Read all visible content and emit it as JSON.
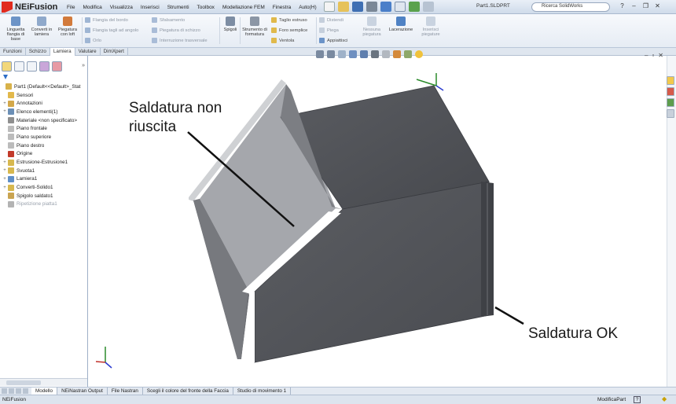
{
  "app": {
    "logo_text": "NEiFusion",
    "document_title": "Part1.SLDPRT",
    "search_placeholder": "Ricerca SolidWorks",
    "menus": [
      "File",
      "Modifica",
      "Visualizza",
      "Inserisci",
      "Strumenti",
      "Toolbox",
      "Modellazione FEM",
      "Finestra",
      "Auto(H)"
    ]
  },
  "ribbon": {
    "linguetta": "Linguetta flangia di base",
    "converti": "Converti in lamiera",
    "piegatura_loft": "Piegatura con loft",
    "flangia_bordo": "Flangia del bordo",
    "flangia_tagli": "Flangia tagli ad angolo",
    "orlo": "Orlo",
    "sfalsamento": "Sfalsamento",
    "piegatura_schizzo": "Piegatura di schizzo",
    "interruzione": "Interruzione trasversale",
    "spigoli": "Spigoli",
    "strumento_formatura": "Strumento di formatura",
    "taglio_estruso": "Taglio estruso",
    "foro_semplice": "Foro semplice",
    "ventola": "Ventola",
    "distendi": "Distendi",
    "piega": "Piega",
    "appiattisci": "Appiattisci",
    "nessuna_piegatura": "Nessuna piegatura",
    "lacerazione": "Lacerazione",
    "inserisci_piegature": "Inserisci piegature"
  },
  "command_tabs": [
    "Funzioni",
    "Schizzo",
    "Lamiera",
    "Valutare",
    "DimXpert"
  ],
  "active_command_tab": "Lamiera",
  "feature_tree": [
    {
      "label": "Part1  (Default<<Default>_Stat",
      "icon": "part-icon",
      "color": "#d8b24a"
    },
    {
      "label": "Sensori",
      "icon": "sensor-icon",
      "color": "#e2b84b"
    },
    {
      "label": "Annotazioni",
      "icon": "annotation-icon",
      "color": "#d3a84a"
    },
    {
      "label": "Elenco elementi(1)",
      "icon": "cutlist-icon",
      "color": "#6b8fb6"
    },
    {
      "label": "Materiale <non specificato>",
      "icon": "material-icon",
      "color": "#8f8f8f"
    },
    {
      "label": "Piano frontale",
      "icon": "plane-icon",
      "color": "#bcbcbc"
    },
    {
      "label": "Piano superiore",
      "icon": "plane-icon",
      "color": "#bcbcbc"
    },
    {
      "label": "Piano destro",
      "icon": "plane-icon",
      "color": "#bcbcbc"
    },
    {
      "label": "Origine",
      "icon": "origin-icon",
      "color": "#c23a2a"
    },
    {
      "label": "Estrusione-Estrusione1",
      "icon": "extrude-icon",
      "color": "#d7b84f"
    },
    {
      "label": "Svuota1",
      "icon": "shell-icon",
      "color": "#d7b84f"
    },
    {
      "label": "Lamiera1",
      "icon": "sheetmetal-icon",
      "color": "#5f8fc8"
    },
    {
      "label": "Converti-Solido1",
      "icon": "convert-icon",
      "color": "#d7b84f"
    },
    {
      "label": "Spigolo saldato1",
      "icon": "weld-icon",
      "color": "#c9a451"
    },
    {
      "label": "Ripetizione piatta1",
      "icon": "flat-pattern-icon",
      "color": "#b3b3b3",
      "faded": true
    }
  ],
  "callouts": {
    "fail": "Saldatura non riuscita",
    "ok": "Saldatura OK"
  },
  "bottom_tabs": [
    "Modello",
    "NEiNastran Output",
    "File Nastran",
    "Scegli il colore del fronte della Faccia",
    "Studio di movimento 1"
  ],
  "status": {
    "left": "NEiFusion",
    "mode": "ModificaPart",
    "help": "?"
  },
  "colors": {
    "part_face_top": "#4f5156",
    "part_face_front": "#56585d",
    "part_face_light": "#9a9ca1",
    "accent_ribbon": "#3b73b9"
  }
}
